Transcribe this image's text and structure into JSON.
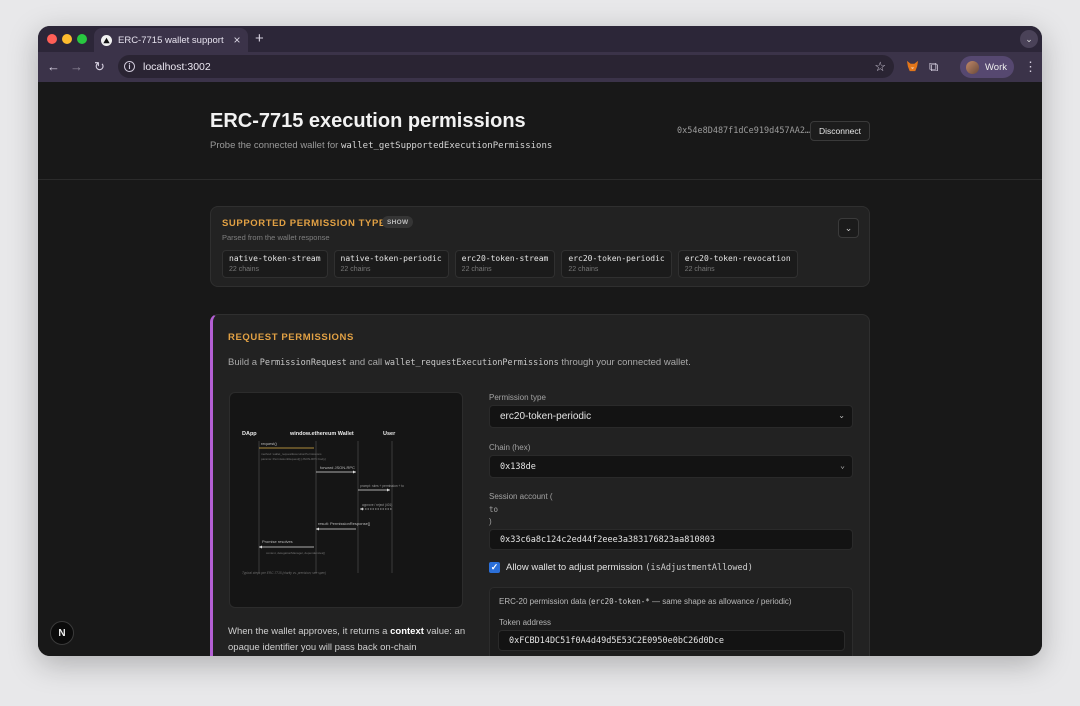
{
  "browser": {
    "tab_title": "ERC-7715 wallet support",
    "tab_close": "×",
    "new_tab": "+",
    "url": "localhost:3002",
    "profile_label": "Work"
  },
  "header": {
    "title": "ERC-7715 execution permissions",
    "subtitle_prefix": "Probe the connected wallet for",
    "subtitle_method": "wallet_getSupportedExecutionPermissions",
    "address": "0x54e8D487f1dCe919d457AA2…",
    "disconnect_label": "Disconnect"
  },
  "supported": {
    "heading": "SUPPORTED PERMISSION TYPES",
    "badge": "SHOW",
    "note": "Parsed from the wallet response",
    "types": [
      {
        "name": "native-token-stream",
        "chains": "22 chains"
      },
      {
        "name": "native-token-periodic",
        "chains": "22 chains"
      },
      {
        "name": "erc20-token-stream",
        "chains": "22 chains"
      },
      {
        "name": "erc20-token-periodic",
        "chains": "22 chains"
      },
      {
        "name": "erc20-token-revocation",
        "chains": "22 chains"
      }
    ]
  },
  "request": {
    "heading": "REQUEST PERMISSIONS",
    "desc_1": "Build a",
    "desc_code_1": "PermissionRequest",
    "desc_2": "and call",
    "desc_code_2": "wallet_requestExecutionPermissions",
    "desc_3": "through your connected wallet.",
    "diagram": {
      "actors": [
        "DApp",
        "window.ethereum Wallet",
        "User"
      ],
      "msg_request": "request()",
      "note_request_1": "method: wallet_requestExecutionPermissions",
      "note_request_2": "params: PermissionRequest[] (JSON-RPC body)",
      "msg_forward": "forward JSON-RPC",
      "msg_prompt": "prompt: rules + permission + to",
      "msg_approve": "approve / reject (401)",
      "msg_result": "result: PermissionResponse[]",
      "msg_resolves": "Promise resolves",
      "note_resolves": "context, delegationManager, dependencies[]",
      "caption": "Typical steps per ERC-7715 (clarity vs. precision; see spec)"
    },
    "when_text_1": "When the wallet approves, it returns a",
    "when_bold": "context",
    "when_text_2": "value: an opaque identifier you will pass back on-chain"
  },
  "form": {
    "permission_type_label": "Permission type",
    "permission_type_value": "erc20-token-periodic",
    "chain_label": "Chain (hex)",
    "chain_value": "0x138de",
    "session_label_1": "Session account (",
    "session_label_code": "to",
    "session_label_2": ")",
    "session_value": "0x33c6a8c124c2ed44f2eee3a383176823aa810803",
    "adjust_label": "Allow wallet to adjust permission",
    "adjust_code": "(isAdjustmentAllowed)",
    "adjust_checked": true,
    "erc20_title_1": "ERC-20 permission data (",
    "erc20_title_code": "erc20-token-*",
    "erc20_title_2": " — same shape as allowance / periodic)",
    "token_label": "Token address",
    "token_value": "0xFCBD14DC51f0A4d49d5E53C2E0950e0bC26d0Dce"
  },
  "next_badge": "N",
  "colors": {
    "accent_heading": "#e2a144",
    "accent_border": "#b35fd3",
    "checkbox": "#2b6fd8"
  }
}
